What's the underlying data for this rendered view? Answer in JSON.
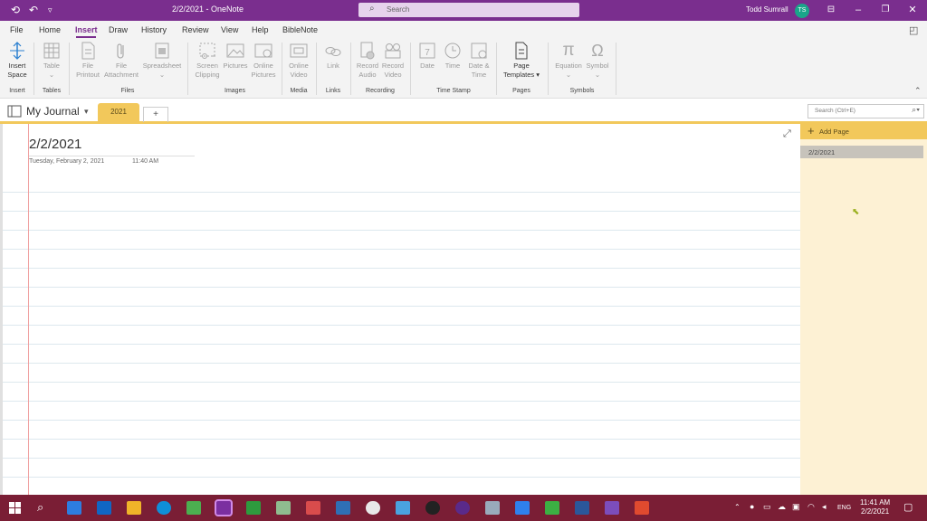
{
  "window": {
    "title": "2/2/2021 - OneNote",
    "search_placeholder": "Search",
    "user_name": "Todd Sumrall",
    "user_initials": "TS"
  },
  "menu": {
    "tabs": [
      "File",
      "Home",
      "Insert",
      "Draw",
      "History",
      "Review",
      "View",
      "Help",
      "BibleNote"
    ],
    "active": "Insert"
  },
  "ribbon": {
    "buttons": {
      "insert_space": [
        "Insert",
        "Space"
      ],
      "table": "Table",
      "file_printout": [
        "File",
        "Printout"
      ],
      "file_attachment": [
        "File",
        "Attachment"
      ],
      "spreadsheet": "Spreadsheet",
      "screen_clipping": [
        "Screen",
        "Clipping"
      ],
      "pictures": "Pictures",
      "online_pictures": [
        "Online",
        "Pictures"
      ],
      "online_video": [
        "Online",
        "Video"
      ],
      "link": "Link",
      "record_audio": [
        "Record",
        "Audio"
      ],
      "record_video": [
        "Record",
        "Video"
      ],
      "date": "Date",
      "time": "Time",
      "date_time": [
        "Date &",
        "Time"
      ],
      "page_templates": [
        "Page",
        "Templates"
      ],
      "equation": "Equation",
      "symbol": "Symbol"
    },
    "groups": [
      "Insert",
      "Tables",
      "Files",
      "Images",
      "Media",
      "Links",
      "Recording",
      "Time Stamp",
      "Pages",
      "Symbols"
    ]
  },
  "notebook": {
    "name": "My Journal",
    "section": "2021",
    "add_section": "+",
    "search_placeholder": "Search (Ctrl+E)"
  },
  "page": {
    "title": "2/2/2021",
    "date": "Tuesday, February 2, 2021",
    "time": "11:40 AM"
  },
  "pages_panel": {
    "add_page": "Add Page",
    "pages": [
      "2/2/2021"
    ]
  },
  "taskbar": {
    "time": "11:41 AM",
    "date": "2/2/2021",
    "language": "ENG"
  }
}
